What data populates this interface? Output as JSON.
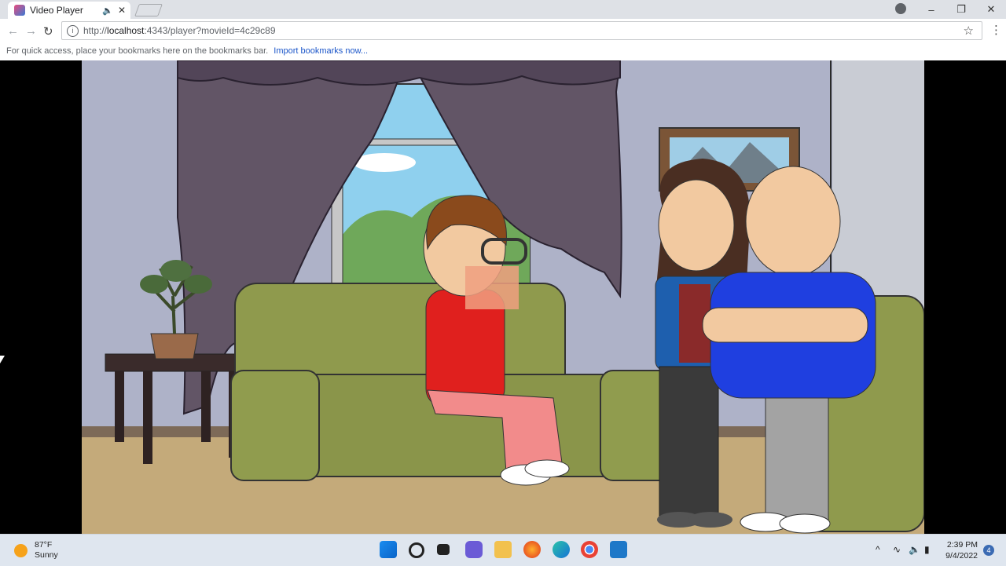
{
  "browser": {
    "tab": {
      "title": "Video Player"
    },
    "address": {
      "prefix": "http://",
      "host": "localhost",
      "rest": ":4343/player?movieId=4c29c89"
    },
    "bookmarks_bar": {
      "message": "For quick access, place your bookmarks here on the bookmarks bar.",
      "import_link": "Import bookmarks now..."
    }
  },
  "video": {
    "scene": "cartoon living room with four characters"
  },
  "taskbar": {
    "weather": {
      "temp": "87°F",
      "condition": "Sunny"
    },
    "clock": {
      "time": "2:39 PM",
      "date": "9/4/2022"
    },
    "notifications_count": "4"
  },
  "colors": {
    "chrome_bg": "#dee1e6",
    "taskbar_bg": "#dfe6ef",
    "link": "#1a55c9",
    "sofa": "#8f9a4d",
    "curtain": "#625566",
    "wall": "#aeb2c8",
    "floor": "#c4aa7a"
  }
}
